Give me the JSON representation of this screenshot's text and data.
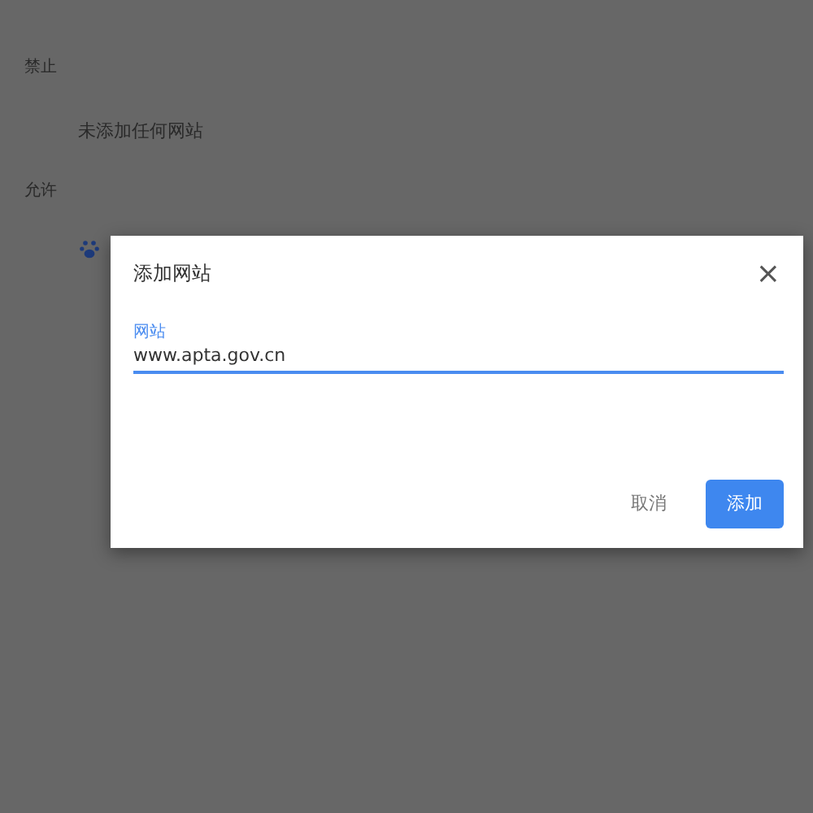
{
  "sections": [
    {
      "heading": "禁止",
      "empty_text": "未添加任何网站"
    },
    {
      "heading": "允许",
      "sites": [
        {
          "kind": "paw"
        }
      ]
    }
  ],
  "dialog": {
    "title": "添加网站",
    "close": "×",
    "field": {
      "label": "网站",
      "value": "www.apta.gov.cn",
      "focused": true
    },
    "buttons": [
      {
        "label": "取消",
        "kind": "text"
      },
      {
        "label": "添加",
        "kind": "primary"
      }
    ]
  }
}
